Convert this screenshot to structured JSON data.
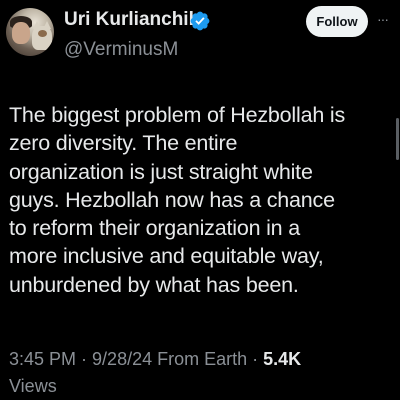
{
  "author": {
    "display_name": "Uri Kurlianchik",
    "handle": "@VerminusM",
    "verified_icon": "verified-badge-icon",
    "verified_color": "#1d9bf0"
  },
  "actions": {
    "follow_label": "Follow",
    "more_icon": "more-options-icon"
  },
  "tweet": {
    "lines": [
      "The biggest problem of Hezbollah is",
      "zero diversity. The entire",
      "organization is just straight white",
      "guys. Hezbollah now has a chance",
      "to reform their organization in a",
      "more inclusive and equitable way,",
      "unburdened by what has been."
    ]
  },
  "meta": {
    "time": "3:45 PM",
    "separator": " · ",
    "date": "9/28/24",
    "source": "From Earth",
    "views_count": "5.4K",
    "views_label": "Views"
  },
  "colors": {
    "background": "#000000",
    "text_primary": "#e7e9ea",
    "text_secondary": "#8b9096",
    "follow_button_bg": "#eff3f4"
  }
}
